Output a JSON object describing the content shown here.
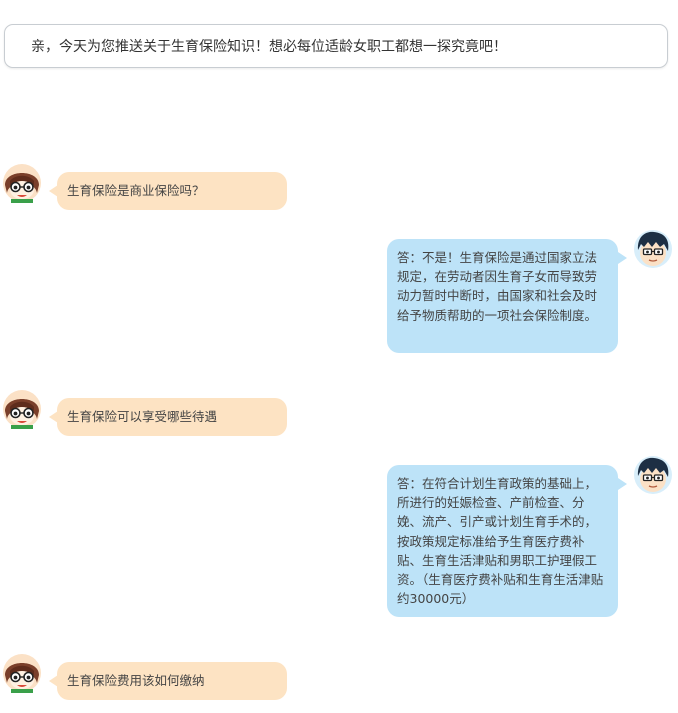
{
  "intro": {
    "text": "亲，今天为您推送关于生育保险知识！想必每位适龄女职工都想一探究竟吧！"
  },
  "chat": {
    "messages": [
      {
        "role": "question",
        "text": "生育保险是商业保险吗？"
      },
      {
        "role": "answer",
        "text": "答：不是！生育保险是通过国家立法规定，在劳动者因生育子女而导致劳动力暂时中断时，由国家和社会及时给予物质帮助的一项社会保险制度。"
      },
      {
        "role": "question",
        "text": "生育保险可以享受哪些待遇"
      },
      {
        "role": "answer",
        "text": "答：在符合计划生育政策的基础上，所进行的妊娠检查、产前检查、分娩、流产、引产或计划生育手术的，按政策规定标准给予生育医疗费补贴、生育生活津贴和男职工护理假工资。（生育医疗费补贴和生育生活津贴约30000元）"
      },
      {
        "role": "question",
        "text": "生育保险费用该如何缴纳"
      }
    ]
  },
  "icons": {
    "asker": "girl-avatar-icon",
    "answerer": "boy-avatar-icon"
  },
  "colors": {
    "question_bubble": "#fde3c3",
    "answer_bubble": "#bde3f8",
    "intro_border": "#c8cdd2"
  }
}
